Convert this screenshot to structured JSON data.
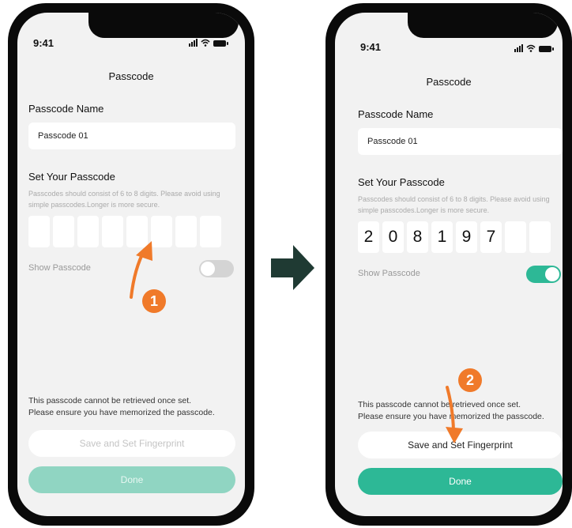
{
  "colors": {
    "accent": "#2db896",
    "accent_disabled": "#90d5c2",
    "annotation": "#f07a2a",
    "arrow": "#1f3a33"
  },
  "status_bar": {
    "time": "9:41"
  },
  "screen1": {
    "title": "Passcode",
    "name_label": "Passcode Name",
    "name_value": "Passcode 01",
    "set_label": "Set Your Passcode",
    "hint": "Passcodes should consist of 6 to 8 digits. Please avoid using simple passcodes.Longer is more secure.",
    "digits": [
      "",
      "",
      "",
      "",
      "",
      "",
      "",
      ""
    ],
    "show_label": "Show Passcode",
    "show_toggle": "off",
    "notice_line1": "This passcode cannot be retrieved once set.",
    "notice_line2": "Please ensure you have memorized the passcode.",
    "save_button": "Save and Set Fingerprint",
    "done_button": "Done",
    "step": "1"
  },
  "screen2": {
    "title": "Passcode",
    "name_label": "Passcode Name",
    "name_value": "Passcode 01",
    "set_label": "Set Your Passcode",
    "hint": "Passcodes should consist of 6 to 8 digits. Please avoid using simple passcodes.Longer is more secure.",
    "digits": [
      "2",
      "0",
      "8",
      "1",
      "9",
      "7",
      "",
      ""
    ],
    "show_label": "Show Passcode",
    "show_toggle": "on",
    "notice_line1": "This passcode cannot be retrieved once set.",
    "notice_line2": "Please ensure you have memorized the passcode.",
    "save_button": "Save and Set Fingerprint",
    "done_button": "Done",
    "step": "2"
  }
}
